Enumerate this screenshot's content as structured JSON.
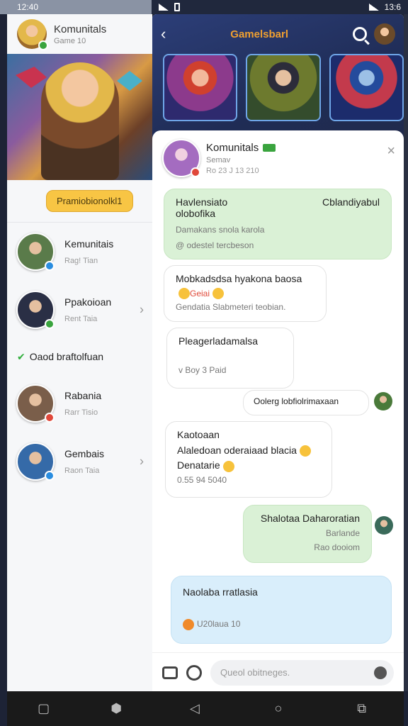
{
  "status": {
    "left_time": "12:40",
    "right_time": "13:6"
  },
  "left": {
    "header": {
      "title": "Komunitals",
      "subtitle": "Game 10"
    },
    "promo_label": "Pramiobionolkl1",
    "contacts": [
      {
        "name": "Kemunitais",
        "sub": "Rag! Tian",
        "badge": "#2a8de0",
        "avatar": "#5a7b4a",
        "chevron": false
      },
      {
        "name": "Ppakoioan",
        "sub": "Rent Taia",
        "badge": "#3aa43e",
        "avatar": "#2a2f45",
        "chevron": true
      },
      {
        "name": "Rabania",
        "sub": "Rarr Tisio",
        "badge": "#e0483a",
        "avatar": "#7a5e4a",
        "chevron": false
      },
      {
        "name": "Gembais",
        "sub": "Raon Taia",
        "badge": "#2a8de0",
        "avatar": "#356aa8",
        "chevron": true
      }
    ],
    "section_label": "Oaod braftolfuan"
  },
  "right": {
    "title": "Gamelsbarl",
    "chat": {
      "name": "Komunitals",
      "status": "Semav",
      "time": "Ro 23 J 13 210",
      "messages": [
        {
          "line1": "Havlensiato",
          "line1_right": "Cblandiyabul",
          "line2": "olobofika",
          "line3": "Damakans snola karola",
          "line4": "@ odestel tercbeson"
        },
        {
          "line1": "Mobkadsdsa hyakona baosa",
          "line2": "Geiai",
          "line3": "Gendatia Slabmeteri teobian."
        },
        {
          "line1": "Pleagerladamalsa",
          "line2": "v Boy 3 Paid"
        },
        {
          "line1": "Oolerg lobfiolrimaxaan"
        },
        {
          "line1": "Kaotoaan",
          "line2": "Alaledoan oderaiaad blacia",
          "line3": "Denatarie",
          "line4": "0.55 94 5040"
        },
        {
          "line1": "Shalotaa Daharoratian",
          "line2": "Barlande",
          "line3": "Rao dooiom"
        },
        {
          "line1": "Naolaba rratlasia",
          "line2": "U20laua 10"
        }
      ],
      "composer_placeholder": "Queol obitneges."
    }
  },
  "colors": {
    "accent_orange": "#f0a030",
    "promo_yellow": "#f8c544",
    "bubble_green": "#daf1d6",
    "bubble_blue": "#d9eefb"
  }
}
